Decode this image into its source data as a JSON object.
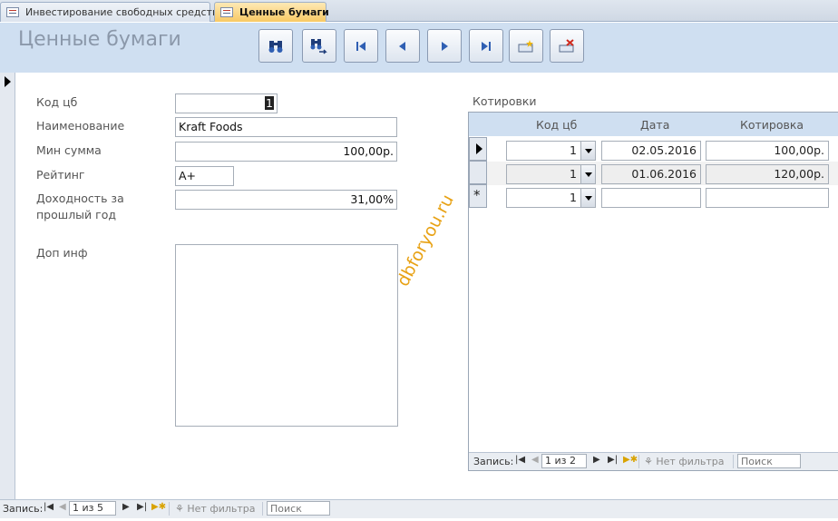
{
  "tabs": [
    {
      "label": "Инвестирование свободных средств",
      "active": false
    },
    {
      "label": "Ценные бумаги",
      "active": true
    }
  ],
  "header": {
    "title": "Ценные бумаги",
    "toolbar": [
      {
        "icon": "binoculars-find-icon"
      },
      {
        "icon": "find-next-icon"
      },
      {
        "icon": "first-record-icon"
      },
      {
        "icon": "previous-record-icon"
      },
      {
        "icon": "next-record-icon"
      },
      {
        "icon": "last-record-icon"
      },
      {
        "icon": "new-record-icon"
      },
      {
        "icon": "delete-record-icon"
      }
    ]
  },
  "form": {
    "kod_label": "Код цб",
    "kod_value": "1",
    "name_label": "Наименование",
    "name_value": "Kraft Foods",
    "min_sum_label": "Мин сумма",
    "min_sum_value": "100,00р.",
    "rating_label": "Рейтинг",
    "rating_value": "A+",
    "yield_label_line1": "Доходность за",
    "yield_label_line2": "прошлый год",
    "yield_value": "31,00%",
    "extra_label": "Доп инф",
    "extra_value": ""
  },
  "subform": {
    "caption": "Котировки",
    "columns": [
      "Код цб",
      "Дата",
      "Котировка"
    ],
    "rows": [
      {
        "kod": "1",
        "date": "02.05.2016",
        "quote": "100,00р."
      },
      {
        "kod": "1",
        "date": "01.06.2016",
        "quote": "120,00р."
      }
    ],
    "new_row": {
      "kod": "1",
      "date": "",
      "quote": ""
    },
    "nav": {
      "label": "Запись:",
      "position": "1 из 2",
      "filter": "Нет фильтра",
      "search_placeholder": "Поиск"
    }
  },
  "main_nav": {
    "label": "Запись:",
    "position": "1 из 5",
    "filter": "Нет фильтра",
    "search_placeholder": "Поиск"
  },
  "watermark": "dbforyou.ru"
}
